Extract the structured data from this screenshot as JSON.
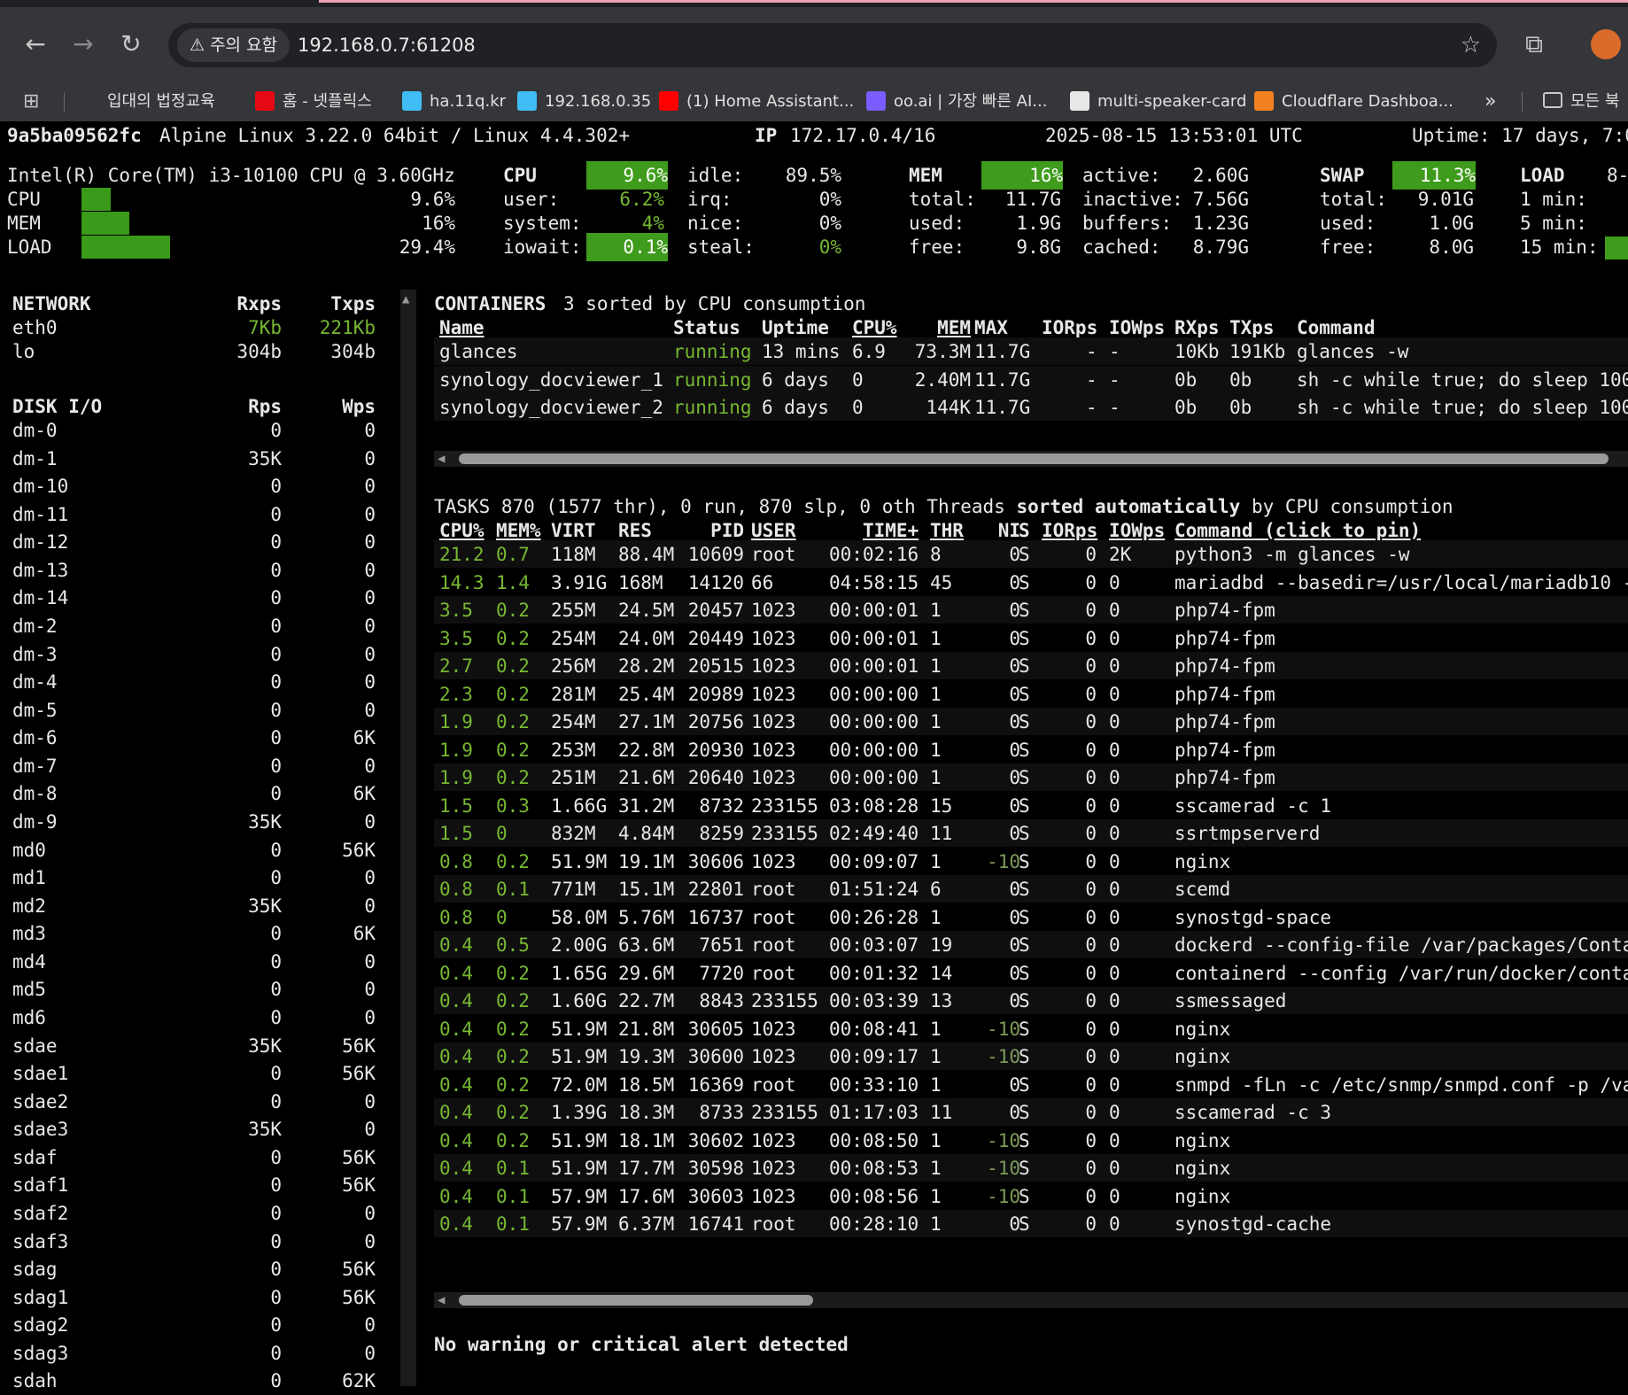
{
  "browser": {
    "nav": {
      "back": "←",
      "forward": "→",
      "reload": "↻"
    },
    "warning_label": "⚠ 주의 요함",
    "url": "192.168.0.7:61208",
    "star": "☆",
    "ext_icon": "⧉",
    "bookmarks": [
      {
        "label": "입대의 법정교육",
        "color": "#35363a"
      },
      {
        "label": "홈 - 넷플릭스",
        "color": "#e50914"
      },
      {
        "label": "ha.11q.kr",
        "color": "#41bdf5"
      },
      {
        "label": "192.168.0.35",
        "color": "#41bdf5"
      },
      {
        "label": "(1) Home Assistant...",
        "color": "#ff0000"
      },
      {
        "label": "oo.ai | 가장 빠른 AI...",
        "color": "#7b5cff"
      },
      {
        "label": "multi-speaker-card",
        "color": "#e8e8e8"
      },
      {
        "label": "Cloudflare Dashboa...",
        "color": "#f48120"
      }
    ],
    "more": "»",
    "all_bookmarks": "모든 북"
  },
  "header": {
    "hostname": "9a5ba09562fc",
    "os": "Alpine Linux 3.22.0 64bit / Linux 4.4.302+",
    "ip_label": "IP",
    "ip": "172.17.0.4/16",
    "datetime": "2025-08-15 13:53:01 UTC",
    "uptime": "Uptime: 17 days, 7:0"
  },
  "quicklook": {
    "cpu_name": "Intel(R) Core(TM) i3-10100 CPU @ 3.60GHz",
    "rows": [
      {
        "label": "CPU",
        "value": "9.6%",
        "fraction": 0.096
      },
      {
        "label": "MEM",
        "value": "16%",
        "fraction": 0.16
      },
      {
        "label": "LOAD",
        "value": "29.4%",
        "fraction": 0.294
      }
    ]
  },
  "cpu": {
    "title": "CPU",
    "total": "9.6%",
    "user_l": "user:",
    "user": "6.2%",
    "system_l": "system:",
    "system": "4%",
    "iowait_l": "iowait:",
    "iowait": "0.1%",
    "idle_l": "idle:",
    "idle": "89.5%",
    "irq_l": "irq:",
    "irq": "0%",
    "nice_l": "nice:",
    "nice": "0%",
    "steal_l": "steal:",
    "steal": "0%"
  },
  "mem": {
    "title": "MEM",
    "percent": "16%",
    "total_l": "total:",
    "total": "11.7G",
    "used_l": "used:",
    "used": "1.9G",
    "free_l": "free:",
    "free": "9.8G",
    "active_l": "active:",
    "active": "2.60G",
    "inactive_l": "inactive:",
    "inactive": "7.56G",
    "buffers_l": "buffers:",
    "buffers": "1.23G",
    "cached_l": "cached:",
    "cached": "8.79G"
  },
  "swap": {
    "title": "SWAP",
    "percent": "11.3%",
    "total_l": "total:",
    "total": "9.01G",
    "used_l": "used:",
    "used": "1.0G",
    "free_l": "free:",
    "free": "8.0G"
  },
  "load": {
    "title": "LOAD",
    "cores": "8-",
    "m1": "1 min:",
    "m5": "5 min:",
    "m15": "15 min:"
  },
  "network": {
    "title": "NETWORK",
    "rx_h": "Rxps",
    "tx_h": "Txps",
    "rows": [
      {
        "name": "eth0",
        "rx": "7Kb",
        "tx": "221Kb",
        "hl": true
      },
      {
        "name": "lo",
        "rx": "304b",
        "tx": "304b",
        "hl": false
      }
    ]
  },
  "diskio": {
    "title": "DISK I/O",
    "r_h": "Rps",
    "w_h": "Wps",
    "rows": [
      {
        "name": "dm-0",
        "r": "0",
        "w": "0"
      },
      {
        "name": "dm-1",
        "r": "35K",
        "w": "0"
      },
      {
        "name": "dm-10",
        "r": "0",
        "w": "0"
      },
      {
        "name": "dm-11",
        "r": "0",
        "w": "0"
      },
      {
        "name": "dm-12",
        "r": "0",
        "w": "0"
      },
      {
        "name": "dm-13",
        "r": "0",
        "w": "0"
      },
      {
        "name": "dm-14",
        "r": "0",
        "w": "0"
      },
      {
        "name": "dm-2",
        "r": "0",
        "w": "0"
      },
      {
        "name": "dm-3",
        "r": "0",
        "w": "0"
      },
      {
        "name": "dm-4",
        "r": "0",
        "w": "0"
      },
      {
        "name": "dm-5",
        "r": "0",
        "w": "0"
      },
      {
        "name": "dm-6",
        "r": "0",
        "w": "6K"
      },
      {
        "name": "dm-7",
        "r": "0",
        "w": "0"
      },
      {
        "name": "dm-8",
        "r": "0",
        "w": "6K"
      },
      {
        "name": "dm-9",
        "r": "35K",
        "w": "0"
      },
      {
        "name": "md0",
        "r": "0",
        "w": "56K"
      },
      {
        "name": "md1",
        "r": "0",
        "w": "0"
      },
      {
        "name": "md2",
        "r": "35K",
        "w": "0"
      },
      {
        "name": "md3",
        "r": "0",
        "w": "6K"
      },
      {
        "name": "md4",
        "r": "0",
        "w": "0"
      },
      {
        "name": "md5",
        "r": "0",
        "w": "0"
      },
      {
        "name": "md6",
        "r": "0",
        "w": "0"
      },
      {
        "name": "sdae",
        "r": "35K",
        "w": "56K"
      },
      {
        "name": "sdae1",
        "r": "0",
        "w": "56K"
      },
      {
        "name": "sdae2",
        "r": "0",
        "w": "0"
      },
      {
        "name": "sdae3",
        "r": "35K",
        "w": "0"
      },
      {
        "name": "sdaf",
        "r": "0",
        "w": "56K"
      },
      {
        "name": "sdaf1",
        "r": "0",
        "w": "56K"
      },
      {
        "name": "sdaf2",
        "r": "0",
        "w": "0"
      },
      {
        "name": "sdaf3",
        "r": "0",
        "w": "0"
      },
      {
        "name": "sdag",
        "r": "0",
        "w": "56K"
      },
      {
        "name": "sdag1",
        "r": "0",
        "w": "56K"
      },
      {
        "name": "sdag2",
        "r": "0",
        "w": "0"
      },
      {
        "name": "sdag3",
        "r": "0",
        "w": "0"
      },
      {
        "name": "sdah",
        "r": "0",
        "w": "62K"
      }
    ]
  },
  "containers": {
    "title": "CONTAINERS",
    "summary": "3 sorted by CPU consumption",
    "headers": {
      "name": "Name",
      "status": "Status",
      "uptime": "Uptime",
      "cpu": "CPU%",
      "mem": "MEM",
      "max": "MAX",
      "iorps": "IORps",
      "iowps": "IOWps",
      "rxps": "RXps",
      "txps": "TXps",
      "command": "Command"
    },
    "rows": [
      {
        "name": "glances",
        "status": "running",
        "uptime": "13 mins",
        "cpu": "6.9",
        "mem": "73.3M",
        "max": "11.7G",
        "iorps": "-",
        "iowps": "-",
        "rxps": "10Kb",
        "txps": "191Kb",
        "command": "glances -w"
      },
      {
        "name": "synology_docviewer_1",
        "status": "running",
        "uptime": "6 days",
        "cpu": "0",
        "mem": "2.40M",
        "max": "11.7G",
        "iorps": "-",
        "iowps": "-",
        "rxps": "0b",
        "txps": "0b",
        "command": "sh -c while true; do sleep 100"
      },
      {
        "name": "synology_docviewer_2",
        "status": "running",
        "uptime": "6 days",
        "cpu": "0",
        "mem": "144K",
        "max": "11.7G",
        "iorps": "-",
        "iowps": "-",
        "rxps": "0b",
        "txps": "0b",
        "command": "sh -c while true; do sleep 100"
      }
    ],
    "scroll_arrow": "◀"
  },
  "tasks": {
    "summary_pre": "TASKS 870 (1577 thr), 0 run, 870 slp, 0 oth Threads",
    "sorted": "sorted automatically",
    "summary_post": "by CPU consumption",
    "headers": {
      "cpu": "CPU%",
      "mem": "MEM%",
      "virt": "VIRT",
      "res": "RES",
      "pid": "PID",
      "user": "USER",
      "time": "TIME+",
      "thr": "THR",
      "ni": "NI",
      "s": "S",
      "iorps": "IORps",
      "iowps": "IOWps",
      "command": "Command (click to pin)"
    },
    "rows": [
      {
        "cpu": "21.2",
        "mem": "0.7",
        "virt": "118M",
        "res": "88.4M",
        "pid": "10609",
        "user": "root",
        "time": "00:02:16",
        "thr": "8",
        "ni": "0",
        "s": "S",
        "ior": "0",
        "iow": "2K",
        "cmd": "python3 -m glances -w"
      },
      {
        "cpu": "14.3",
        "mem": "1.4",
        "virt": "3.91G",
        "res": "168M",
        "pid": "14120",
        "user": "66",
        "time": "04:58:15",
        "thr": "45",
        "ni": "0",
        "s": "S",
        "ior": "0",
        "iow": "0",
        "cmd": "mariadbd --basedir=/usr/local/mariadb10 --"
      },
      {
        "cpu": "3.5",
        "mem": "0.2",
        "virt": "255M",
        "res": "24.5M",
        "pid": "20457",
        "user": "1023",
        "time": "00:00:01",
        "thr": "1",
        "ni": "0",
        "s": "S",
        "ior": "0",
        "iow": "0",
        "cmd": "php74-fpm"
      },
      {
        "cpu": "3.5",
        "mem": "0.2",
        "virt": "254M",
        "res": "24.0M",
        "pid": "20449",
        "user": "1023",
        "time": "00:00:01",
        "thr": "1",
        "ni": "0",
        "s": "S",
        "ior": "0",
        "iow": "0",
        "cmd": "php74-fpm"
      },
      {
        "cpu": "2.7",
        "mem": "0.2",
        "virt": "256M",
        "res": "28.2M",
        "pid": "20515",
        "user": "1023",
        "time": "00:00:01",
        "thr": "1",
        "ni": "0",
        "s": "S",
        "ior": "0",
        "iow": "0",
        "cmd": "php74-fpm"
      },
      {
        "cpu": "2.3",
        "mem": "0.2",
        "virt": "281M",
        "res": "25.4M",
        "pid": "20989",
        "user": "1023",
        "time": "00:00:00",
        "thr": "1",
        "ni": "0",
        "s": "S",
        "ior": "0",
        "iow": "0",
        "cmd": "php74-fpm"
      },
      {
        "cpu": "1.9",
        "mem": "0.2",
        "virt": "254M",
        "res": "27.1M",
        "pid": "20756",
        "user": "1023",
        "time": "00:00:00",
        "thr": "1",
        "ni": "0",
        "s": "S",
        "ior": "0",
        "iow": "0",
        "cmd": "php74-fpm"
      },
      {
        "cpu": "1.9",
        "mem": "0.2",
        "virt": "253M",
        "res": "22.8M",
        "pid": "20930",
        "user": "1023",
        "time": "00:00:00",
        "thr": "1",
        "ni": "0",
        "s": "S",
        "ior": "0",
        "iow": "0",
        "cmd": "php74-fpm"
      },
      {
        "cpu": "1.9",
        "mem": "0.2",
        "virt": "251M",
        "res": "21.6M",
        "pid": "20640",
        "user": "1023",
        "time": "00:00:00",
        "thr": "1",
        "ni": "0",
        "s": "S",
        "ior": "0",
        "iow": "0",
        "cmd": "php74-fpm"
      },
      {
        "cpu": "1.5",
        "mem": "0.3",
        "virt": "1.66G",
        "res": "31.2M",
        "pid": "8732",
        "user": "233155",
        "time": "03:08:28",
        "thr": "15",
        "ni": "0",
        "s": "S",
        "ior": "0",
        "iow": "0",
        "cmd": "sscamerad -c 1"
      },
      {
        "cpu": "1.5",
        "mem": "0",
        "virt": "832M",
        "res": "4.84M",
        "pid": "8259",
        "user": "233155",
        "time": "02:49:40",
        "thr": "11",
        "ni": "0",
        "s": "S",
        "ior": "0",
        "iow": "0",
        "cmd": "ssrtmpserverd"
      },
      {
        "cpu": "0.8",
        "mem": "0.2",
        "virt": "51.9M",
        "res": "19.1M",
        "pid": "30606",
        "user": "1023",
        "time": "00:09:07",
        "thr": "1",
        "ni": "-10",
        "s": "S",
        "ior": "0",
        "iow": "0",
        "cmd": "nginx"
      },
      {
        "cpu": "0.8",
        "mem": "0.1",
        "virt": "771M",
        "res": "15.1M",
        "pid": "22801",
        "user": "root",
        "time": "01:51:24",
        "thr": "6",
        "ni": "0",
        "s": "S",
        "ior": "0",
        "iow": "0",
        "cmd": "scemd"
      },
      {
        "cpu": "0.8",
        "mem": "0",
        "virt": "58.0M",
        "res": "5.76M",
        "pid": "16737",
        "user": "root",
        "time": "00:26:28",
        "thr": "1",
        "ni": "0",
        "s": "S",
        "ior": "0",
        "iow": "0",
        "cmd": "synostgd-space"
      },
      {
        "cpu": "0.4",
        "mem": "0.5",
        "virt": "2.00G",
        "res": "63.6M",
        "pid": "7651",
        "user": "root",
        "time": "00:03:07",
        "thr": "19",
        "ni": "0",
        "s": "S",
        "ior": "0",
        "iow": "0",
        "cmd": "dockerd --config-file /var/packages/Conta"
      },
      {
        "cpu": "0.4",
        "mem": "0.2",
        "virt": "1.65G",
        "res": "29.6M",
        "pid": "7720",
        "user": "root",
        "time": "00:01:32",
        "thr": "14",
        "ni": "0",
        "s": "S",
        "ior": "0",
        "iow": "0",
        "cmd": "containerd --config /var/run/docker/conta"
      },
      {
        "cpu": "0.4",
        "mem": "0.2",
        "virt": "1.60G",
        "res": "22.7M",
        "pid": "8843",
        "user": "233155",
        "time": "00:03:39",
        "thr": "13",
        "ni": "0",
        "s": "S",
        "ior": "0",
        "iow": "0",
        "cmd": "ssmessaged"
      },
      {
        "cpu": "0.4",
        "mem": "0.2",
        "virt": "51.9M",
        "res": "21.8M",
        "pid": "30605",
        "user": "1023",
        "time": "00:08:41",
        "thr": "1",
        "ni": "-10",
        "s": "S",
        "ior": "0",
        "iow": "0",
        "cmd": "nginx"
      },
      {
        "cpu": "0.4",
        "mem": "0.2",
        "virt": "51.9M",
        "res": "19.3M",
        "pid": "30600",
        "user": "1023",
        "time": "00:09:17",
        "thr": "1",
        "ni": "-10",
        "s": "S",
        "ior": "0",
        "iow": "0",
        "cmd": "nginx"
      },
      {
        "cpu": "0.4",
        "mem": "0.2",
        "virt": "72.0M",
        "res": "18.5M",
        "pid": "16369",
        "user": "root",
        "time": "00:33:10",
        "thr": "1",
        "ni": "0",
        "s": "S",
        "ior": "0",
        "iow": "0",
        "cmd": "snmpd -fLn -c /etc/snmp/snmpd.conf -p /va"
      },
      {
        "cpu": "0.4",
        "mem": "0.2",
        "virt": "1.39G",
        "res": "18.3M",
        "pid": "8733",
        "user": "233155",
        "time": "01:17:03",
        "thr": "11",
        "ni": "0",
        "s": "S",
        "ior": "0",
        "iow": "0",
        "cmd": "sscamerad -c 3"
      },
      {
        "cpu": "0.4",
        "mem": "0.2",
        "virt": "51.9M",
        "res": "18.1M",
        "pid": "30602",
        "user": "1023",
        "time": "00:08:50",
        "thr": "1",
        "ni": "-10",
        "s": "S",
        "ior": "0",
        "iow": "0",
        "cmd": "nginx"
      },
      {
        "cpu": "0.4",
        "mem": "0.1",
        "virt": "51.9M",
        "res": "17.7M",
        "pid": "30598",
        "user": "1023",
        "time": "00:08:53",
        "thr": "1",
        "ni": "-10",
        "s": "S",
        "ior": "0",
        "iow": "0",
        "cmd": "nginx"
      },
      {
        "cpu": "0.4",
        "mem": "0.1",
        "virt": "57.9M",
        "res": "17.6M",
        "pid": "30603",
        "user": "1023",
        "time": "00:08:56",
        "thr": "1",
        "ni": "-10",
        "s": "S",
        "ior": "0",
        "iow": "0",
        "cmd": "nginx"
      },
      {
        "cpu": "0.4",
        "mem": "0.1",
        "virt": "57.9M",
        "res": "6.37M",
        "pid": "16741",
        "user": "root",
        "time": "00:28:10",
        "thr": "1",
        "ni": "0",
        "s": "S",
        "ior": "0",
        "iow": "0",
        "cmd": "synostgd-cache"
      }
    ],
    "scroll_arrow": "◀"
  },
  "alert": "No warning or critical alert detected",
  "colors": {
    "accent_green": "#3f9b1c",
    "text_green": "#77b832",
    "muted_ni": "#7a9a5a"
  }
}
